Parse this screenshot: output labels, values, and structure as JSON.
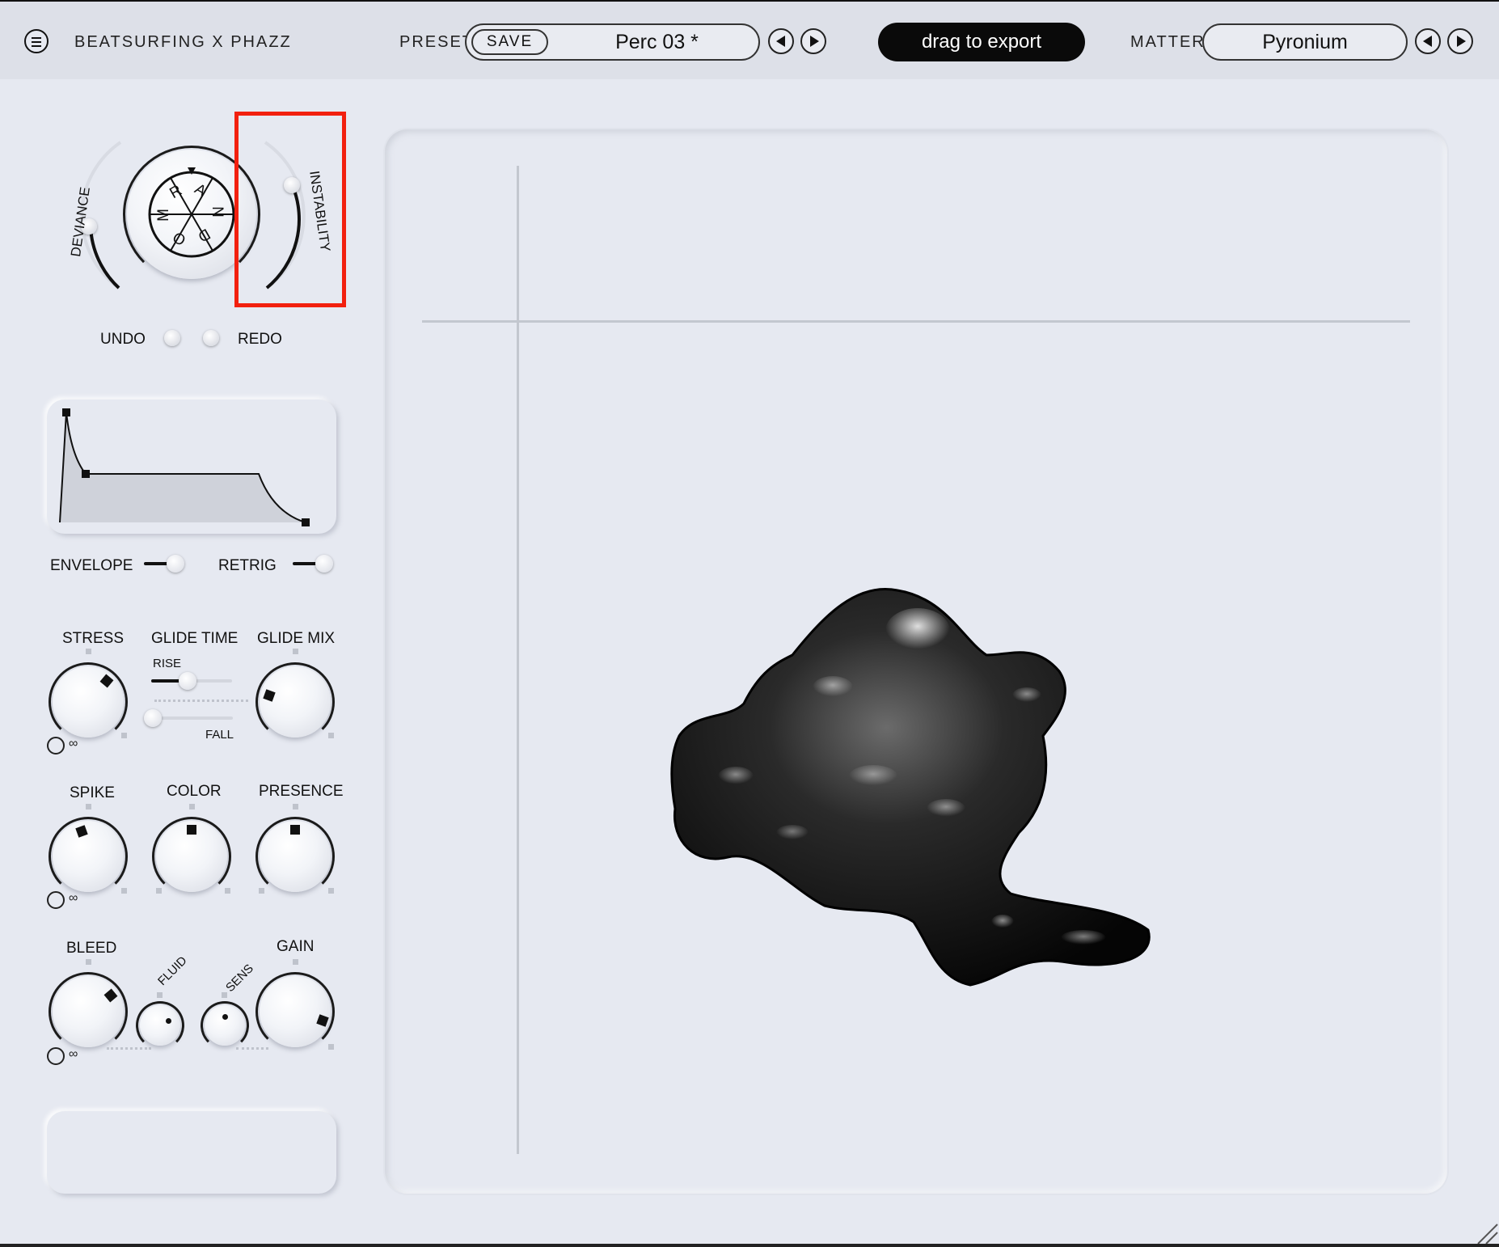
{
  "header": {
    "brand": "BEATSURFING X PHAZZ",
    "preset_label": "PRESET",
    "save_label": "SAVE",
    "preset_name": "Perc 03 *",
    "export_label": "drag to export",
    "matter_label": "MATTER",
    "matter_name": "Pyronium"
  },
  "random": {
    "deviance_label": "DEVIANCE",
    "instability_label": "INSTABILITY",
    "wheel_letters": [
      "R",
      "A",
      "N",
      "D",
      "O",
      "M"
    ],
    "undo_label": "UNDO",
    "redo_label": "REDO"
  },
  "envelope": {
    "envelope_label": "ENVELOPE",
    "retrig_label": "RETRIG"
  },
  "controls": {
    "stress": "STRESS",
    "glide_time": "GLIDE TIME",
    "rise": "RISE",
    "fall": "FALL",
    "glide_mix": "GLIDE MIX",
    "spike": "SPIKE",
    "color": "COLOR",
    "presence": "PRESENCE",
    "bleed": "BLEED",
    "fluid": "FLUID",
    "sens": "SENS",
    "gain": "GAIN"
  },
  "colors": {
    "background": "#e6e9f1",
    "accent": "#0a0a0a",
    "highlight": "#f2200f"
  },
  "icons": {
    "menu": "hamburger-icon",
    "prev": "triangle-left-icon",
    "next": "triangle-right-icon",
    "link": "link-icon",
    "resize": "resize-grip-icon"
  }
}
